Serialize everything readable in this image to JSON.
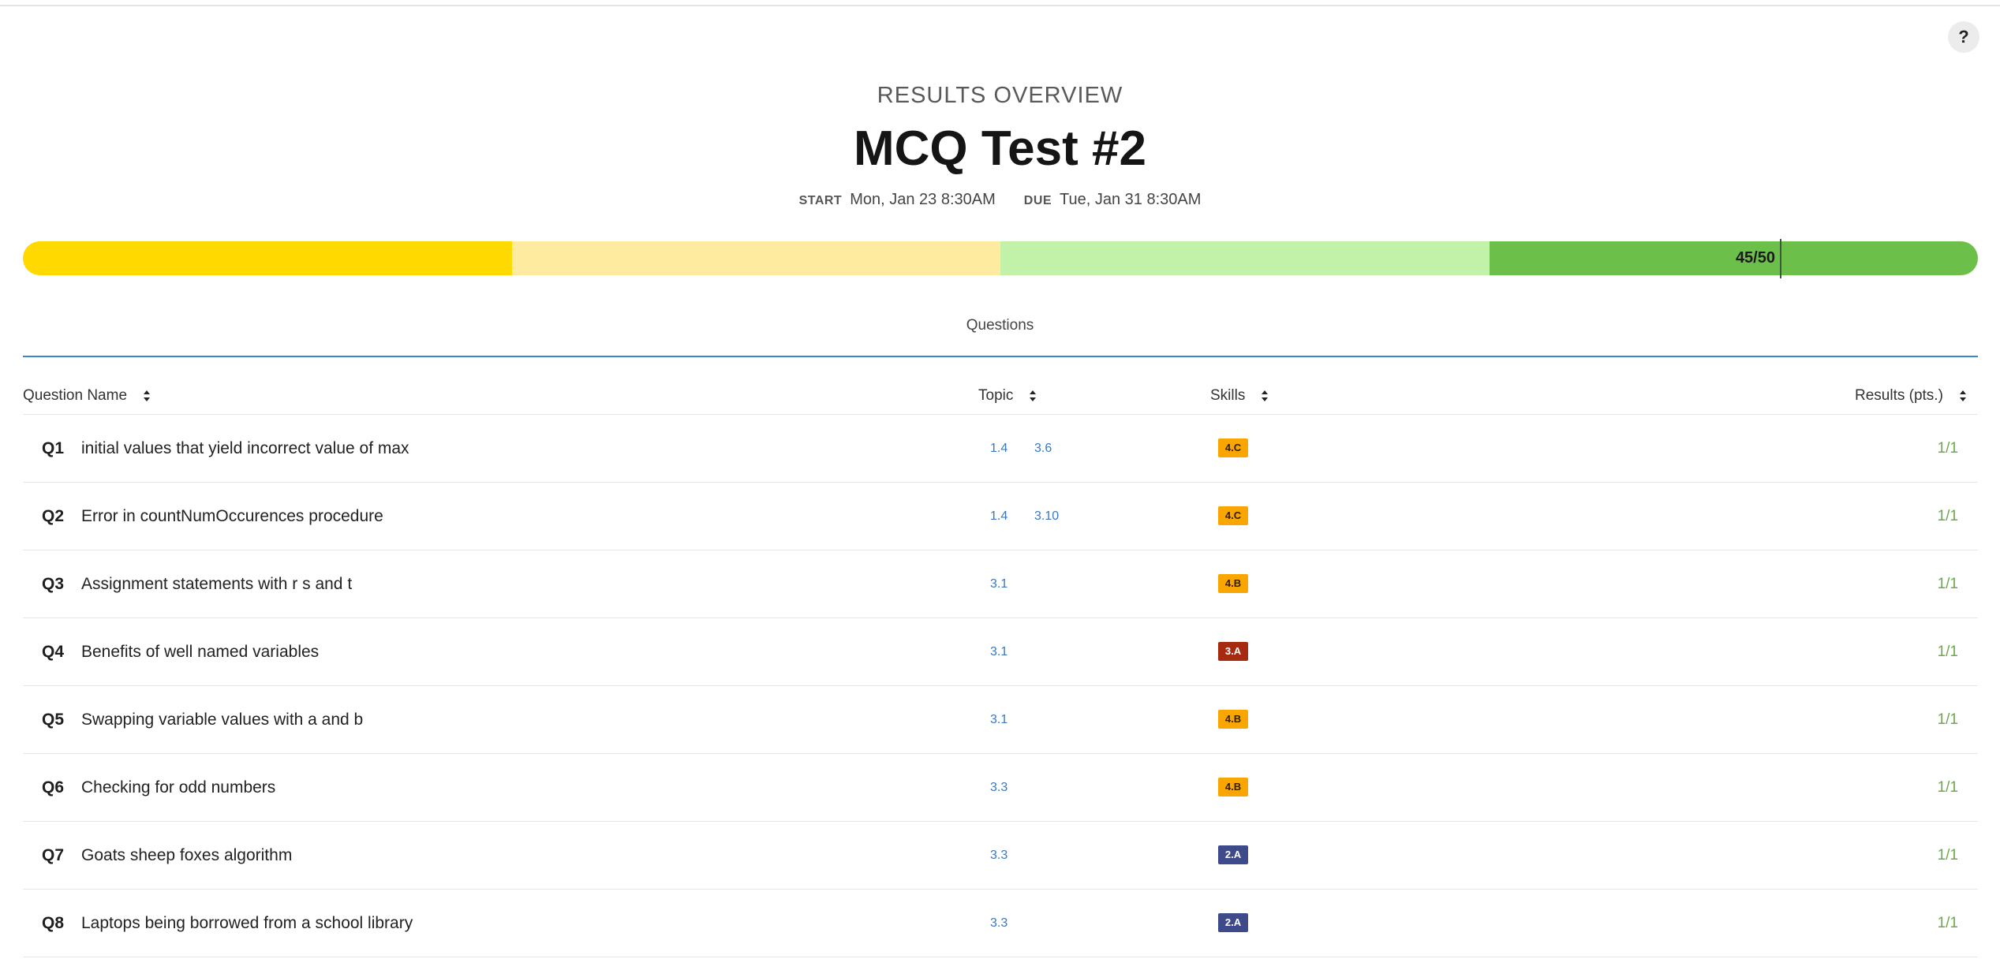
{
  "header": {
    "overview_label": "RESULTS OVERVIEW",
    "title": "MCQ Test #2",
    "start_label": "START",
    "start_value": "Mon, Jan 23 8:30AM",
    "due_label": "DUE",
    "due_value": "Tue, Jan 31 8:30AM"
  },
  "help": {
    "label": "?"
  },
  "progress": {
    "score_text": "45/50",
    "score_fraction": 0.9,
    "segment_colors": [
      "#ffd900",
      "#feeba0",
      "#c2f2a8",
      "#6cc04a"
    ]
  },
  "tabs": {
    "questions_label": "Questions",
    "underline_color": "#3a86c8"
  },
  "table": {
    "headers": {
      "question_name": "Question Name",
      "topic": "Topic",
      "skills": "Skills",
      "results": "Results (pts.)"
    },
    "rows": [
      {
        "num": "Q1",
        "name": "initial values that yield incorrect value of max",
        "topics": [
          "1.4",
          "3.6"
        ],
        "skill": "4.C",
        "result": "1/1"
      },
      {
        "num": "Q2",
        "name": "Error in countNumOccurences procedure",
        "topics": [
          "1.4",
          "3.10"
        ],
        "skill": "4.C",
        "result": "1/1"
      },
      {
        "num": "Q3",
        "name": "Assignment statements with r s and t",
        "topics": [
          "3.1"
        ],
        "skill": "4.B",
        "result": "1/1"
      },
      {
        "num": "Q4",
        "name": "Benefits of well named variables",
        "topics": [
          "3.1"
        ],
        "skill": "3.A",
        "result": "1/1"
      },
      {
        "num": "Q5",
        "name": "Swapping variable values with a and b",
        "topics": [
          "3.1"
        ],
        "skill": "4.B",
        "result": "1/1"
      },
      {
        "num": "Q6",
        "name": "Checking for odd numbers",
        "topics": [
          "3.3"
        ],
        "skill": "4.B",
        "result": "1/1"
      },
      {
        "num": "Q7",
        "name": "Goats sheep foxes algorithm",
        "topics": [
          "3.3"
        ],
        "skill": "2.A",
        "result": "1/1"
      },
      {
        "num": "Q8",
        "name": "Laptops being borrowed from a school library",
        "topics": [
          "3.3"
        ],
        "skill": "2.A",
        "result": "1/1"
      }
    ]
  },
  "skill_colors": {
    "4.C": {
      "bg": "#f9a602",
      "fg": "#2a2000"
    },
    "4.B": {
      "bg": "#f9a602",
      "fg": "#2a2000"
    },
    "3.A": {
      "bg": "#a52a10",
      "fg": "#ffffff"
    },
    "2.A": {
      "bg": "#3f4a8a",
      "fg": "#ffffff"
    }
  }
}
